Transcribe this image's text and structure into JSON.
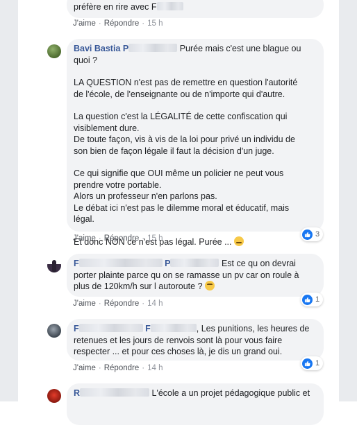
{
  "actions": {
    "like": "J'aime",
    "reply": "Répondre",
    "dot": "·"
  },
  "comments": [
    {
      "text_lines": [
        "préfère en rire avec F"
      ],
      "time": "15 h"
    },
    {
      "author": "Bavi Bastia",
      "author_suffix": "P",
      "first_line": "Purée mais c'est une blague ou",
      "first_line_2": "quoi ?",
      "paragraphs": [
        [
          "LA QUESTION n'est pas de remettre en question l'autorité",
          "de l'école, de l'enseignante ou de n'importe qui d'autre."
        ],
        [
          "La question c'est la LÉGALITÉ de cette confiscation qui",
          "visiblement dure.",
          "De toute façon, vis à vis de la loi pour privé un individu de",
          "son bien de façon légale il faut la décision d'un juge."
        ],
        [
          "Ce qui signifie que OUI même un policier ne peut vous",
          "prendre votre portable.",
          "Alors un professeur n'en parlons pas.",
          "Le débat ici n'est pas le dilemme moral et éducatif, mais",
          "légal."
        ],
        [
          "Et donc NON ce n'est pas légal. Purée ..."
        ]
      ],
      "time": "15 h",
      "reactions": "3"
    },
    {
      "author": "F",
      "author_suffix": "P",
      "line1": "Est ce qu on devrai",
      "lines": [
        "porter plainte parce qu on se ramasse un pv car on roule à",
        "plus de 120km/h sur l autoroute ?"
      ],
      "time": "14 h",
      "reactions": "1"
    },
    {
      "author": "F",
      "author_suffix": "F",
      "line1": ", Les punitions, les heures de",
      "lines": [
        "retenues et les jours de renvois sont là pour vous faire",
        "respecter ... et pour ces choses là, je dis un grand oui."
      ],
      "time": "14 h",
      "reactions": "1"
    },
    {
      "author": "R",
      "line1": "L'école a un projet pédagogique public et"
    }
  ],
  "colors": {
    "name": "#385898",
    "bubble": "#f2f3f5",
    "like": "#1877f2",
    "meta": "#90949c"
  },
  "icons": [
    "avatar-bavi",
    "avatar-f1",
    "avatar-f2",
    "avatar-r",
    "like-icon",
    "unamused-emoji",
    "thinking-emoji"
  ]
}
